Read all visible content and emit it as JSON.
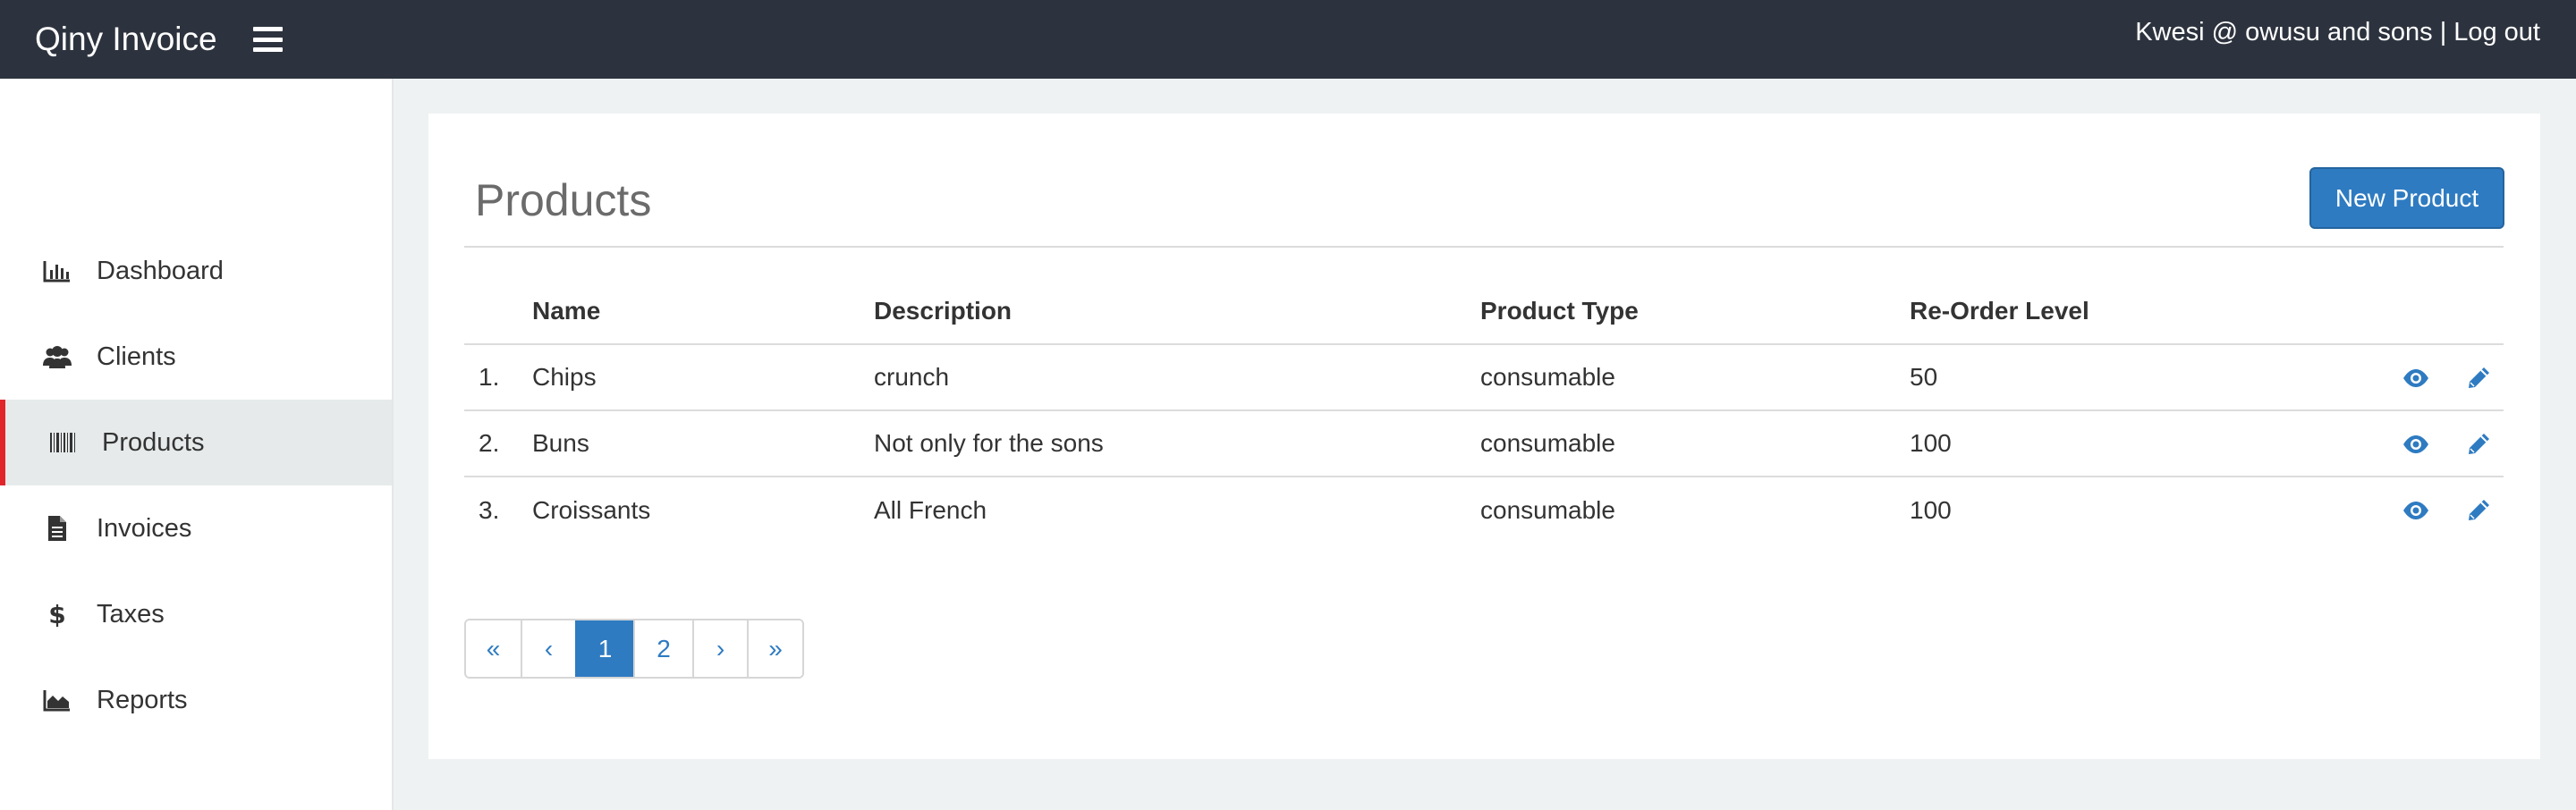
{
  "app": {
    "brand": "Qiny Invoice"
  },
  "header": {
    "user_label": "Kwesi @ owusu and sons",
    "separator": "|",
    "logout_label": "Log out"
  },
  "sidebar": {
    "items": [
      {
        "label": "Dashboard",
        "icon": "bar-chart-icon",
        "active": false
      },
      {
        "label": "Clients",
        "icon": "users-icon",
        "active": false
      },
      {
        "label": "Products",
        "icon": "barcode-icon",
        "active": true
      },
      {
        "label": "Invoices",
        "icon": "file-text-icon",
        "active": false
      },
      {
        "label": "Taxes",
        "icon": "dollar-icon",
        "active": false
      },
      {
        "label": "Reports",
        "icon": "area-chart-icon",
        "active": false
      }
    ]
  },
  "main": {
    "title": "Products",
    "new_button_label": "New Product",
    "table": {
      "columns": [
        "",
        "Name",
        "Description",
        "Product Type",
        "Re-Order Level"
      ],
      "rows": [
        {
          "num": "1.",
          "name": "Chips",
          "description": "crunch",
          "type": "consumable",
          "level": "50"
        },
        {
          "num": "2.",
          "name": "Buns",
          "description": "Not only for the sons",
          "type": "consumable",
          "level": "100"
        },
        {
          "num": "3.",
          "name": "Croissants",
          "description": "All French",
          "type": "consumable",
          "level": "100"
        }
      ],
      "row_actions": [
        "eye-icon",
        "pencil-icon"
      ]
    },
    "pagination": {
      "first": "«",
      "prev": "‹",
      "pages": [
        "1",
        "2"
      ],
      "current": "1",
      "next": "›",
      "last": "»"
    }
  },
  "colors": {
    "navbar": "#2d333e",
    "accent": "#2e7bc1",
    "active_marker": "#e0262b",
    "background": "#eef2f2"
  }
}
